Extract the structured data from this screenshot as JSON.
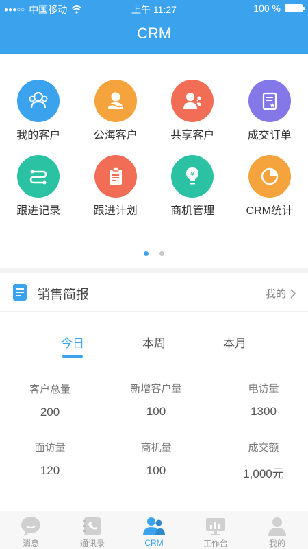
{
  "status_bar": {
    "carrier": "中国移动",
    "time": "上午 11:27",
    "battery": "100 %"
  },
  "header": {
    "title": "CRM"
  },
  "modules": [
    {
      "label": "我的客户",
      "icon": "customers-icon",
      "color": "#3ba3ee"
    },
    {
      "label": "公海客户",
      "icon": "public-customer-icon",
      "color": "#f5a33c"
    },
    {
      "label": "共享客户",
      "icon": "shared-customer-icon",
      "color": "#f26d55"
    },
    {
      "label": "成交订单",
      "icon": "order-icon",
      "color": "#8478e8"
    },
    {
      "label": "跟进记录",
      "icon": "follow-record-icon",
      "color": "#2bc2a3"
    },
    {
      "label": "跟进计划",
      "icon": "follow-plan-icon",
      "color": "#f26d55"
    },
    {
      "label": "商机管理",
      "icon": "lightbulb-icon",
      "color": "#2bc2a3"
    },
    {
      "label": "CRM统计",
      "icon": "pie-chart-icon",
      "color": "#f5a33c"
    }
  ],
  "sales_report": {
    "title": "销售简报",
    "filter": "我的",
    "tabs": [
      "今日",
      "本周",
      "本月"
    ],
    "active_tab": "今日",
    "stats": [
      {
        "label": "客户总量",
        "value": "200"
      },
      {
        "label": "新增客户量",
        "value": "100"
      },
      {
        "label": "电访量",
        "value": "1300"
      },
      {
        "label": "面访量",
        "value": "120"
      },
      {
        "label": "商机量",
        "value": "100"
      },
      {
        "label": "成交额",
        "value": "1,000元"
      }
    ]
  },
  "tab_bar": [
    {
      "label": "消息",
      "icon": "message-icon"
    },
    {
      "label": "通讯录",
      "icon": "contacts-icon"
    },
    {
      "label": "CRM",
      "icon": "crm-icon",
      "active": true
    },
    {
      "label": "工作台",
      "icon": "workbench-icon"
    },
    {
      "label": "我的",
      "icon": "profile-icon"
    }
  ],
  "colors": {
    "accent": "#3ba3ee",
    "inactive": "#999999"
  }
}
